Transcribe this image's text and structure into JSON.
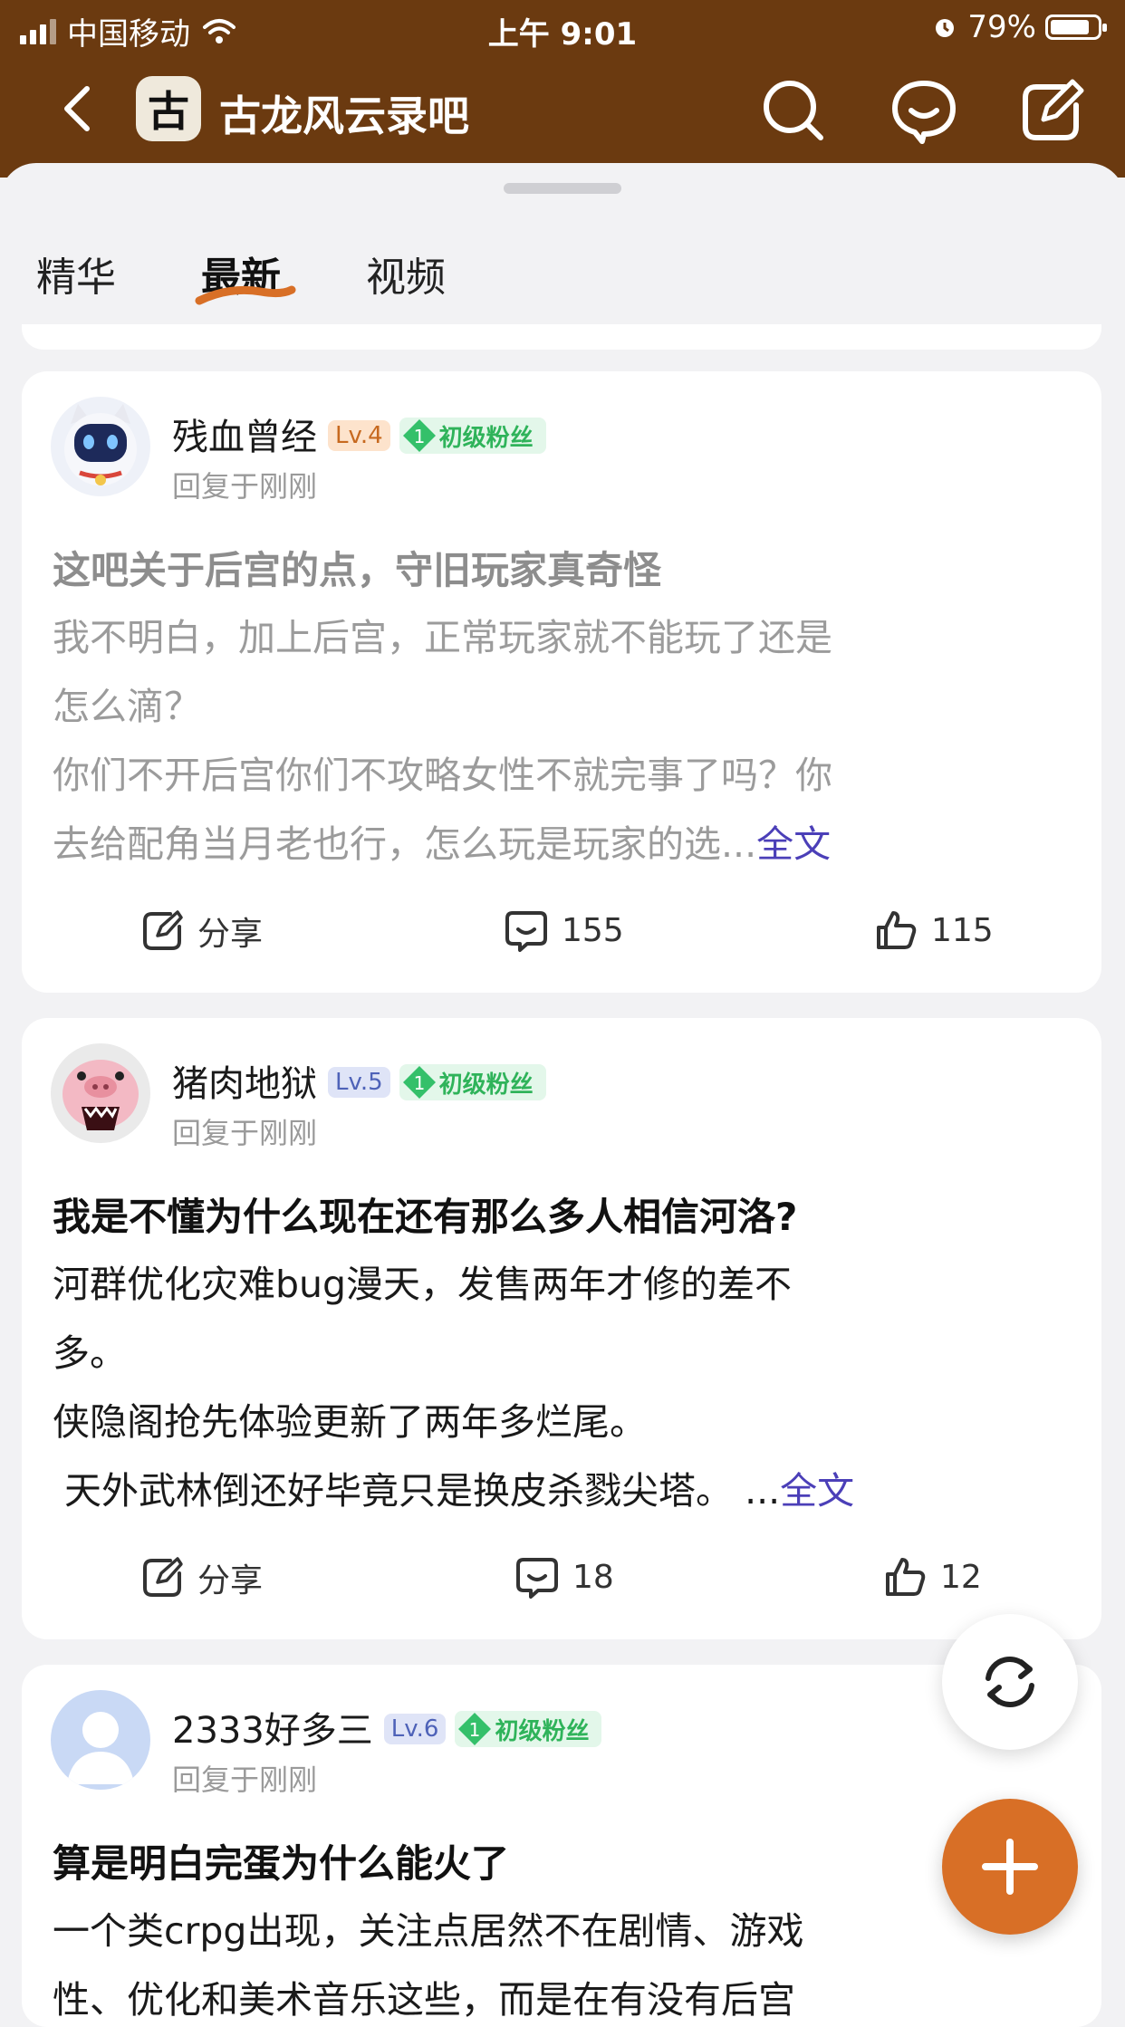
{
  "status_bar": {
    "carrier": "中国移动",
    "time": "上午 9:01",
    "battery": "79%"
  },
  "header": {
    "logo_char": "古",
    "title": "古龙风云录吧"
  },
  "tabs": [
    {
      "label": "精华"
    },
    {
      "label": "最新"
    },
    {
      "label": "视频"
    }
  ],
  "colors": {
    "header_bg": "#6b3a10",
    "tab_underline": "#d86f26",
    "more_link": "#4b3fb8",
    "fab": "#d86f26",
    "fan_green": "#2fb35a"
  },
  "posts": [
    {
      "user": "残血曾经",
      "level": "Lv.4",
      "fan_level": "1",
      "fan_badge": "初级粉丝",
      "reply_time": "回复于刚刚",
      "title": "这吧关于后宫的点，守旧玩家真奇怪",
      "body_lines": [
        "我不明白，加上后宫，正常玩家就不能玩了还是",
        "怎么滴？",
        "你们不开后宫你们不攻略女性不就完事了吗？你",
        "去给配角当月老也行，怎么玩是玩家的选..."
      ],
      "more": "全文",
      "share": "分享",
      "comments": "155",
      "likes": "115"
    },
    {
      "user": "猪肉地狱",
      "level": "Lv.5",
      "fan_level": "1",
      "fan_badge": "初级粉丝",
      "reply_time": "回复于刚刚",
      "title": "我是不懂为什么现在还有那么多人相信河洛?",
      "body_lines": [
        "河群优化灾难bug漫天，发售两年才修的差不",
        "多。",
        "侠隐阁抢先体验更新了两年多烂尾。",
        " 天外武林倒还好毕竟只是换皮杀戮尖塔。 ..."
      ],
      "more": "全文",
      "share": "分享",
      "comments": "18",
      "likes": "12"
    },
    {
      "user": "2333好多三",
      "level": "Lv.6",
      "fan_level": "1",
      "fan_badge": "初级粉丝",
      "reply_time": "回复于刚刚",
      "title": "算是明白完蛋为什么能火了",
      "body_lines": [
        "一个类crpg出现，关注点居然不在剧情、游戏",
        "性、优化和美术音乐这些，而是在有没有后宫"
      ]
    }
  ]
}
